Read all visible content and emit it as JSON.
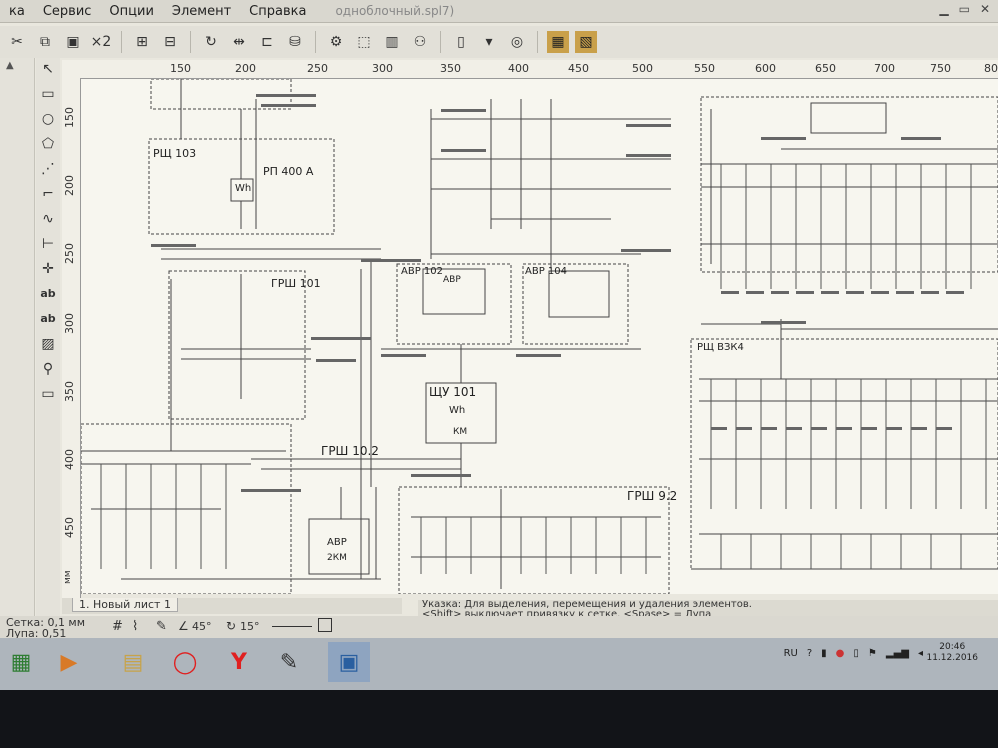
{
  "menu": {
    "items": [
      "ка",
      "Сервис",
      "Опции",
      "Элемент",
      "Справка"
    ],
    "document_title": "одноблочный.spl7)"
  },
  "toolbar": {
    "copies_label": "×2",
    "icons": [
      "scissors-icon",
      "copy-icon",
      "paste-icon",
      "group-icon",
      "ungroup-icon",
      "rotate-icon",
      "mirror-icon",
      "align-icon",
      "library-icon",
      "properties-icon",
      "binoculars-icon",
      "page-icon",
      "zoom-icon",
      "tool-a-icon",
      "tool-b-icon"
    ]
  },
  "tools": {
    "text_a": "ab",
    "text_b": "ab"
  },
  "ruler": {
    "top_ticks": [
      "150",
      "200",
      "250",
      "300",
      "350",
      "400",
      "450",
      "500",
      "550",
      "600",
      "650",
      "700",
      "750",
      "800"
    ],
    "left_ticks": [
      "150",
      "200",
      "250",
      "300",
      "350",
      "400",
      "450"
    ],
    "unit": "мм"
  },
  "diagram": {
    "labels": {
      "rsh103": "РЩ 103",
      "rp400": "РП 400 А",
      "wh": "Wh",
      "grsh101": "ГРШ 101",
      "avr102": "АВР 102",
      "avr104": "АВР 104",
      "avr": "АВР",
      "shu101": "ЩУ 101",
      "wh2": "Wh",
      "km": "КМ",
      "grsh102": "ГРШ 10.2",
      "grsh92": "ГРШ 9.2",
      "rsh_vzk4": "РЩ ВЗК4",
      "avr_bottom": "АВР",
      "avr_bottom2": "2КМ"
    }
  },
  "sheet_tab": {
    "label": "1. Новый лист 1"
  },
  "hint": {
    "line1": "Указка: Для выделения, перемещения и удаления элементов.",
    "line2": "<Shift> выключает привязку к сетке. <Spase> = Лупа"
  },
  "status": {
    "grid": "Сетка: 0,1 мм",
    "zoom": "Лупа:   0,51",
    "angle1": "45°",
    "angle2": "15°"
  },
  "tray": {
    "lang": "RU",
    "time": "20:46",
    "date": "11.12.2016"
  }
}
